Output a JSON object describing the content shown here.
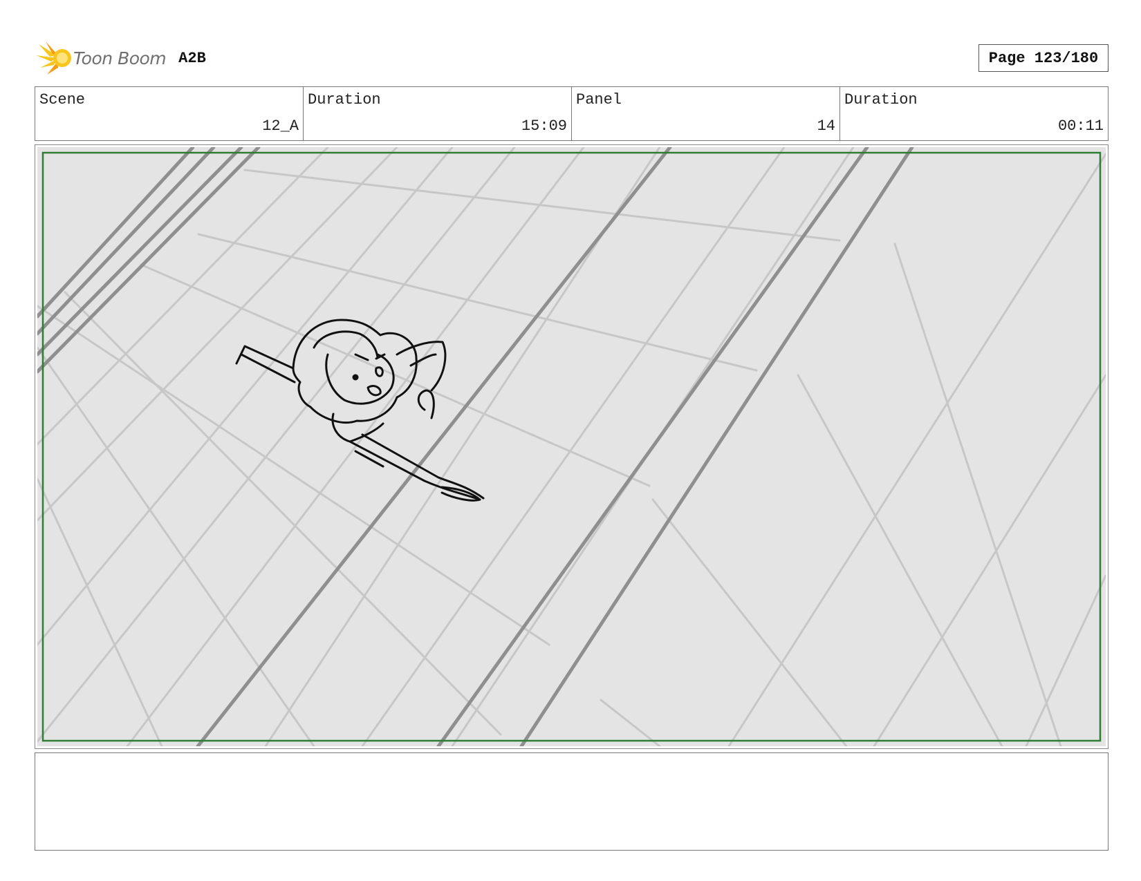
{
  "header": {
    "logo_text": "Toon Boom",
    "project": "A2B",
    "page_label": "Page 123/180"
  },
  "info": {
    "scene_label": "Scene",
    "scene_value": "12_A",
    "scene_duration_label": "Duration",
    "scene_duration_value": "15:09",
    "panel_label": "Panel",
    "panel_value": "14",
    "panel_duration_label": "Duration",
    "panel_duration_value": "00:11"
  },
  "panel": {
    "description": "",
    "safe_frame_color": "#2e7d32",
    "background_color": "#e4e4e4"
  },
  "notes": {
    "text": ""
  },
  "colors": {
    "logo_yellow": "#f7c51e",
    "logo_orange": "#f39c12",
    "sketch_light": "#c7c7c7",
    "sketch_dark": "#8f8f8f",
    "ink": "#111111"
  }
}
